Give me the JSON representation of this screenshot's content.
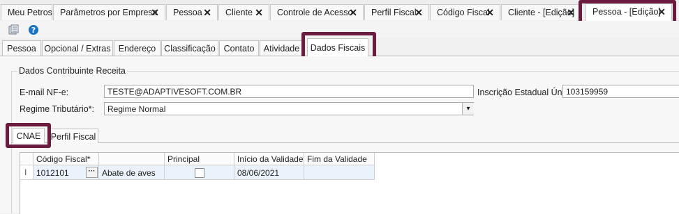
{
  "doc_tabs": [
    {
      "label": "Meu Petros",
      "closable": false
    },
    {
      "label": "Parâmetros por Empresa",
      "closable": true
    },
    {
      "label": "Pessoa",
      "closable": true
    },
    {
      "label": "Cliente",
      "closable": true
    },
    {
      "label": "Controle de Acesso",
      "closable": true
    },
    {
      "label": "Perfil Fiscal",
      "closable": true
    },
    {
      "label": "Código Fiscal",
      "closable": true
    },
    {
      "label": "Cliente - [Edição]",
      "closable": true
    },
    {
      "label": "Pessoa - [Edição]",
      "closable": true,
      "active": true
    }
  ],
  "close_glyph": "✕",
  "toolbar": {
    "icons": [
      "records-icon",
      "help-icon"
    ]
  },
  "inner_tabs": [
    {
      "label": "Pessoa"
    },
    {
      "label": "Opcional / Extras"
    },
    {
      "label": "Endereço"
    },
    {
      "label": "Classificação"
    },
    {
      "label": "Contato"
    },
    {
      "label": "Atividade"
    },
    {
      "label": "Dados Fiscais",
      "active": true
    }
  ],
  "group": {
    "title": "Dados Contribuinte Receita"
  },
  "form": {
    "email_label": "E-mail NF-e:",
    "email_value": "TESTE@ADAPTIVESOFT.COM.BR",
    "ie_label": "Inscrição Estadual Única:",
    "ie_value": "103159959",
    "regime_label": "Regime Tributário*:",
    "regime_value": "Regime Normal"
  },
  "sub_tabs": [
    {
      "label": "CNAE",
      "active": true
    },
    {
      "label": "Perfil Fiscal"
    }
  ],
  "grid": {
    "columns": [
      "Código Fiscal*",
      "",
      "Principal",
      "Início da Validade*",
      "Fim da Validade"
    ],
    "rows": [
      {
        "indicator": "I",
        "codigo": "1012101",
        "descricao": "Abate de aves",
        "principal": false,
        "inicio": "08/06/2021",
        "fim": ""
      }
    ]
  },
  "colors": {
    "highlight": "#6b1b3f",
    "help_icon": "#1a73c9"
  }
}
